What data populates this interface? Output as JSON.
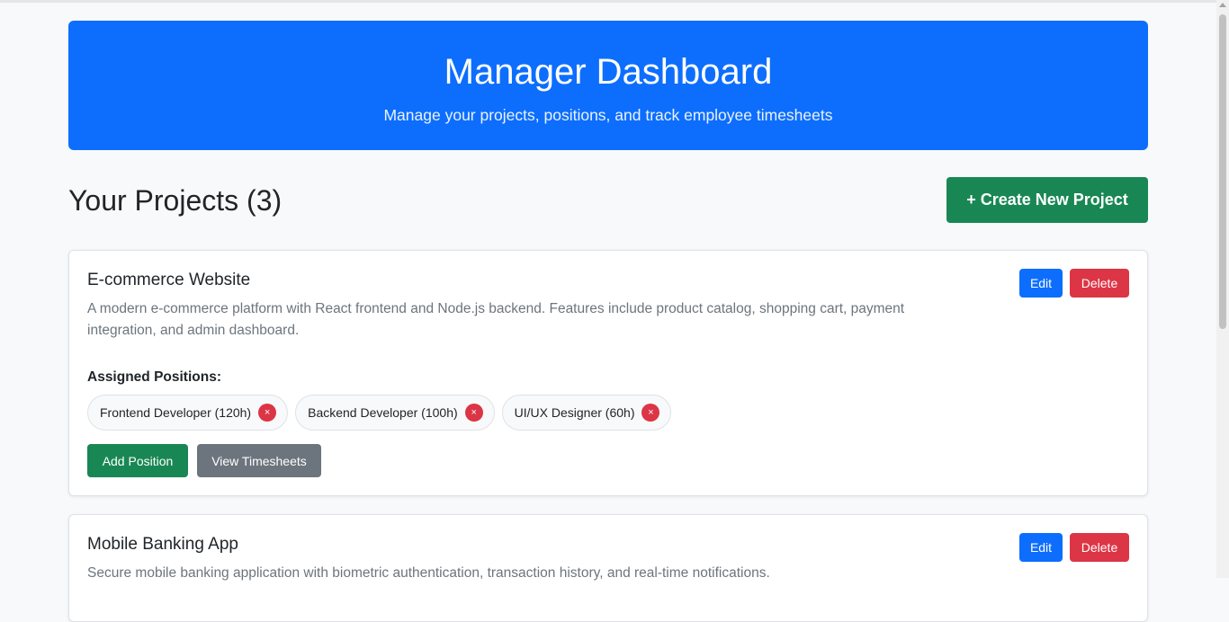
{
  "hero": {
    "title": "Manager Dashboard",
    "subtitle": "Manage your projects, positions, and track employee timesheets"
  },
  "projects_section": {
    "heading": "Your Projects (3)",
    "create_button": "+ Create New Project"
  },
  "projects": [
    {
      "title": "E-commerce Website",
      "description": "A modern e-commerce platform with React frontend and Node.js backend. Features include product catalog, shopping cart, payment integration, and admin dashboard.",
      "edit_label": "Edit",
      "delete_label": "Delete",
      "positions_label": "Assigned Positions:",
      "positions": [
        {
          "label": "Frontend Developer (120h)",
          "remove": "×"
        },
        {
          "label": "Backend Developer (100h)",
          "remove": "×"
        },
        {
          "label": "UI/UX Designer (60h)",
          "remove": "×"
        }
      ],
      "add_position_label": "Add Position",
      "view_timesheets_label": "View Timesheets"
    },
    {
      "title": "Mobile Banking App",
      "description": "Secure mobile banking application with biometric authentication, transaction history, and real-time notifications.",
      "edit_label": "Edit",
      "delete_label": "Delete"
    }
  ],
  "colors": {
    "primary": "#0d6efd",
    "success": "#198754",
    "danger": "#dc3545",
    "secondary": "#6c757d"
  }
}
